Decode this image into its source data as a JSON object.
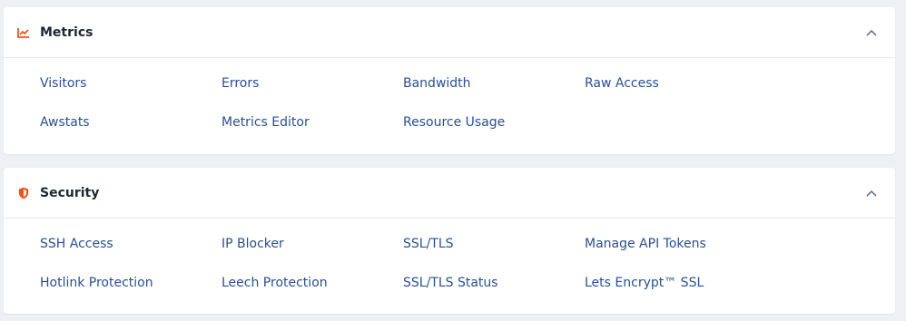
{
  "colors": {
    "accent": "#e8561e",
    "link": "#2b4f93",
    "title": "#1d2733",
    "chevron": "#6b7688"
  },
  "sections": [
    {
      "title": "Metrics",
      "icon": "trending-up-icon",
      "links": [
        "Visitors",
        "Errors",
        "Bandwidth",
        "Raw Access",
        "Awstats",
        "Metrics Editor",
        "Resource Usage"
      ]
    },
    {
      "title": "Security",
      "icon": "shield-icon",
      "links": [
        "SSH Access",
        "IP Blocker",
        "SSL/TLS",
        "Manage API Tokens",
        "Hotlink Protection",
        "Leech Protection",
        "SSL/TLS Status",
        "Lets Encrypt™ SSL"
      ]
    }
  ]
}
